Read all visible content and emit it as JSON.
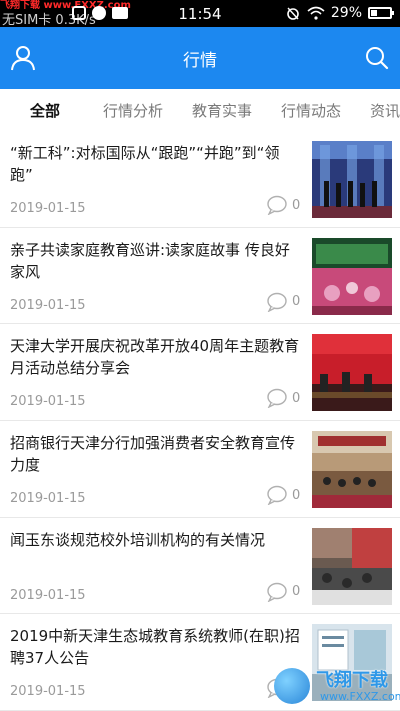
{
  "status_bar": {
    "watermark": "飞翔下载 www.FXXZ.com",
    "carrier": "无SIM卡 0.3K/s",
    "time": "11:54",
    "battery": "29%",
    "battery_level": 0.29,
    "icons": [
      "image-icon",
      "alert-icon",
      "mail-icon",
      "alarm-icon",
      "wifi-icon",
      "signal-icon"
    ]
  },
  "header": {
    "title": "行情",
    "left_icon": "user-icon",
    "right_icon": "search-icon",
    "color": "#1c88f0"
  },
  "tabs": [
    {
      "label": "全部",
      "active": true
    },
    {
      "label": "行情分析",
      "active": false
    },
    {
      "label": "教育实事",
      "active": false
    },
    {
      "label": "行情动态",
      "active": false
    },
    {
      "label": "资讯",
      "active": false
    }
  ],
  "news": [
    {
      "title": "“新工科”:对标国际从“跟跑”“并跑”到“领跑”",
      "date": "2019-01-15",
      "comments": "0"
    },
    {
      "title": "亲子共读家庭教育巡讲:读家庭故事 传良好家风",
      "date": "2019-01-15",
      "comments": "0"
    },
    {
      "title": "天津大学开展庆祝改革开放40周年主题教育月活动总结分享会",
      "date": "2019-01-15",
      "comments": "0"
    },
    {
      "title": "招商银行天津分行加强消费者安全教育宣传力度",
      "date": "2019-01-15",
      "comments": "0"
    },
    {
      "title": "闻玉东谈规范校外培训机构的有关情况",
      "date": "2019-01-15",
      "comments": "0"
    },
    {
      "title": "2019中新天津生态城教育系统教师(在职)招聘37人公告",
      "date": "2019-01-15",
      "comments": "0"
    }
  ],
  "watermark_bottom": {
    "text": "飞翔下载",
    "url": "www.FXXZ.com"
  }
}
